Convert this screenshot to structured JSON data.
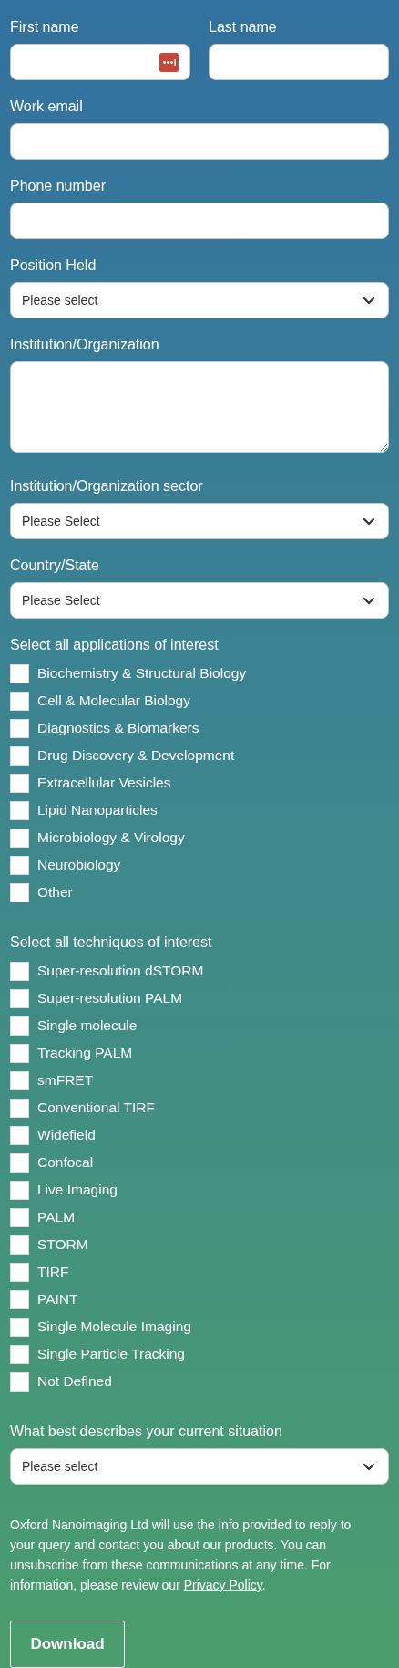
{
  "items": [
    {
      "kind": "pair",
      "fields": [
        {
          "kind": "text",
          "label": "First name",
          "autofill_icon": true
        },
        {
          "kind": "text",
          "label": "Last name",
          "autofill_icon": false
        }
      ]
    },
    {
      "kind": "text",
      "label": "Work email"
    },
    {
      "kind": "text",
      "label": "Phone number"
    },
    {
      "kind": "select",
      "label": "Position Held",
      "value": "Please select"
    },
    {
      "kind": "textarea",
      "label": "Institution/Organization"
    },
    {
      "kind": "select",
      "label": "Institution/Organization sector",
      "value": "Please Select"
    },
    {
      "kind": "select",
      "label": "Country/State",
      "value": "Please Select"
    },
    {
      "kind": "checkboxes",
      "title": "Select all applications of interest",
      "options": [
        {
          "label": "Biochemistry & Structural Biology",
          "checked": false
        },
        {
          "label": "Cell & Molecular Biology",
          "checked": false
        },
        {
          "label": "Diagnostics & Biomarkers",
          "checked": false
        },
        {
          "label": "Drug Discovery & Development",
          "checked": false
        },
        {
          "label": "Extracellular Vesicles",
          "checked": false
        },
        {
          "label": "Lipid Nanoparticles",
          "checked": false
        },
        {
          "label": "Microbiology & Virology",
          "checked": false
        },
        {
          "label": "Neurobiology",
          "checked": false
        },
        {
          "label": "Other",
          "checked": false
        }
      ]
    },
    {
      "kind": "checkboxes",
      "title": "Select all techniques of interest",
      "options": [
        {
          "label": "Super-resolution dSTORM",
          "checked": false
        },
        {
          "label": "Super-resolution PALM",
          "checked": false
        },
        {
          "label": "Single molecule",
          "checked": false
        },
        {
          "label": "Tracking PALM",
          "checked": false
        },
        {
          "label": "smFRET",
          "checked": false
        },
        {
          "label": "Conventional TIRF",
          "checked": false
        },
        {
          "label": "Widefield",
          "checked": false
        },
        {
          "label": "Confocal",
          "checked": false
        },
        {
          "label": "Live Imaging",
          "checked": false
        },
        {
          "label": "PALM",
          "checked": false
        },
        {
          "label": "STORM",
          "checked": false
        },
        {
          "label": "TIRF",
          "checked": false
        },
        {
          "label": "PAINT",
          "checked": false
        },
        {
          "label": "Single Molecule Imaging",
          "checked": false
        },
        {
          "label": "Single Particle Tracking",
          "checked": false
        },
        {
          "label": "Not Defined",
          "checked": false
        }
      ]
    },
    {
      "kind": "select",
      "label": "What best describes your current situation",
      "value": "Please select"
    },
    {
      "kind": "consent",
      "text_before": "Oxford Nanoimaging Ltd will use the info provided to reply to your query and contact you about our products. You can unsubscribe from these communications at any time. For information, please review our ",
      "link": "Privacy Policy",
      "text_after": "."
    },
    {
      "kind": "button",
      "label": "Download"
    }
  ]
}
